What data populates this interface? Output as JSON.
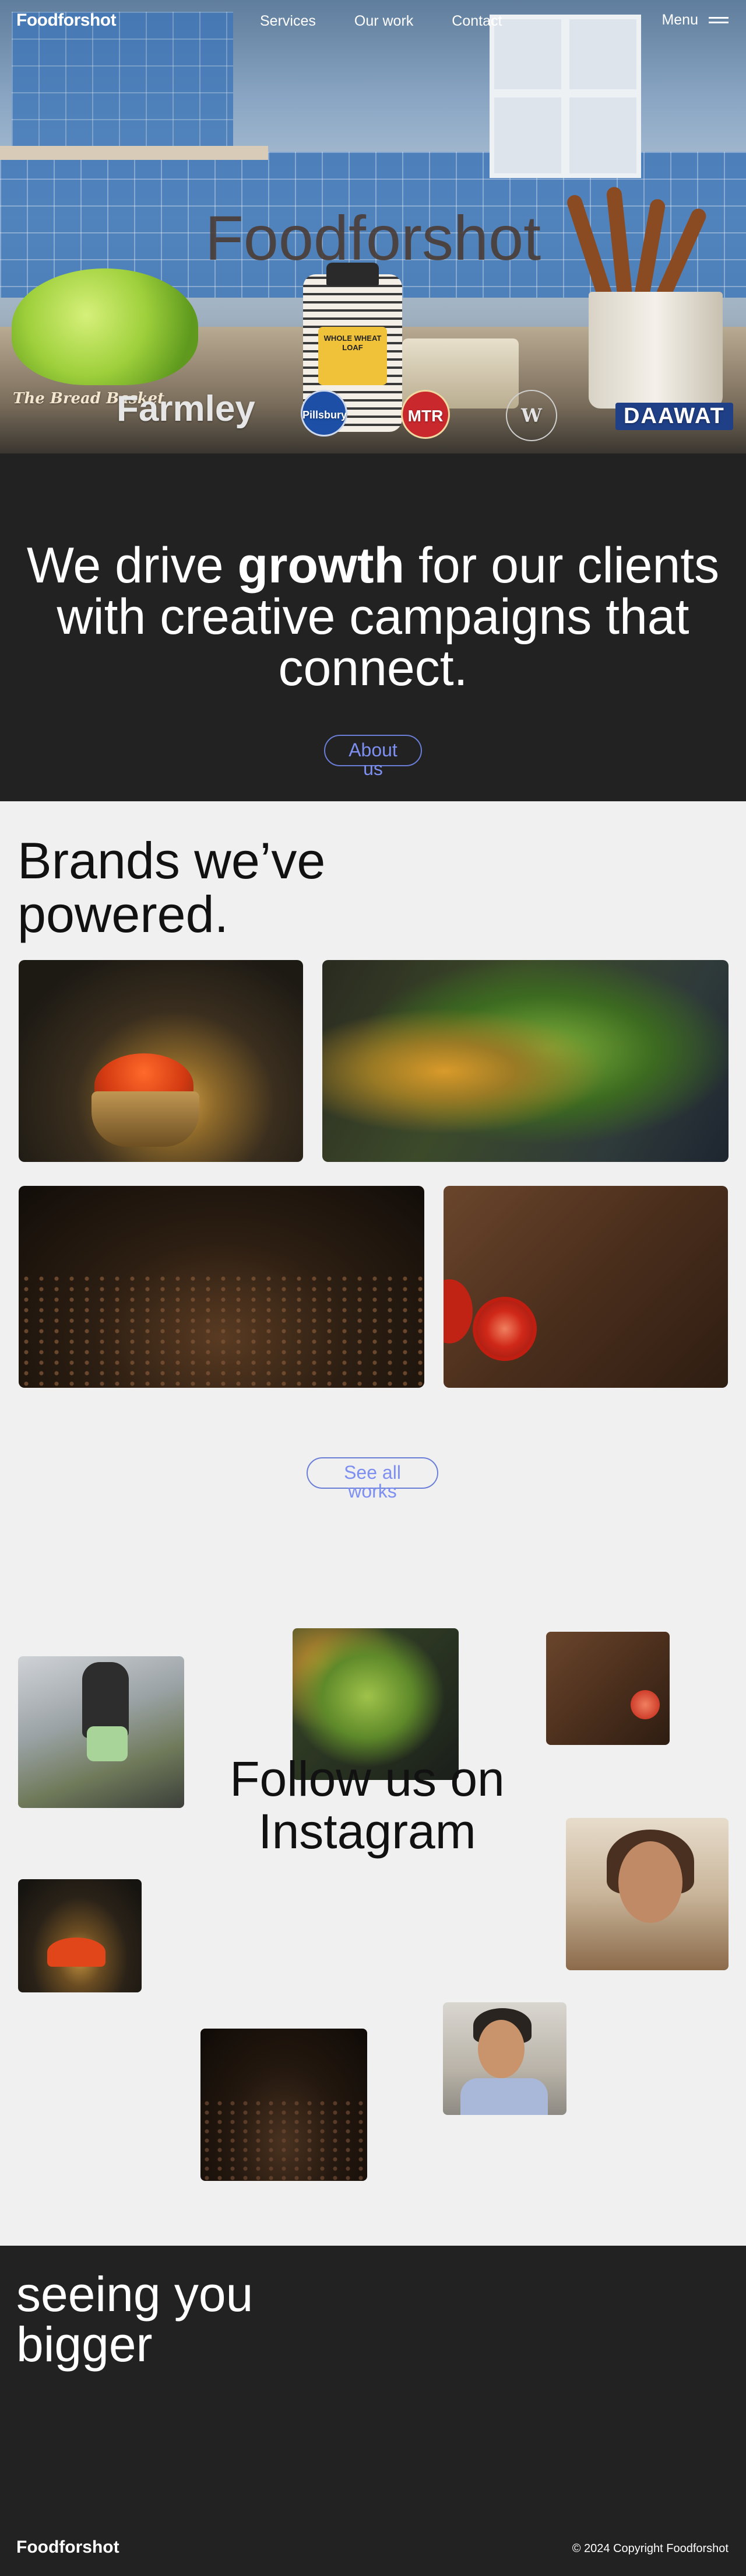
{
  "nav": {
    "logo": "Foodforshot",
    "links": [
      "Services",
      "Our work",
      "Contact"
    ],
    "menu_label": "Menu"
  },
  "hero": {
    "title": "Foodforshot",
    "jar_label": "WHOLE WHEAT LOAF",
    "brand_logos": {
      "parle": "The Bread Basket",
      "farmley": "Farmley",
      "pillsbury": "Pillsbury",
      "mtr": "MTR",
      "wb": "W",
      "daawat": "DAAWAT"
    }
  },
  "growth": {
    "text_before": "We drive ",
    "text_bold": "growth",
    "text_after": " for our clients with creative campaigns that connect.",
    "button": "About us"
  },
  "brands": {
    "title_line1": "Brands we’ve",
    "title_line2": "powered.",
    "button": "See all works"
  },
  "instagram": {
    "title_line1": "Follow us on",
    "title_line2": "Instagram"
  },
  "footer": {
    "tagline_line1": "seeing you",
    "tagline_line2": "bigger",
    "logo": "Foodforshot",
    "copyright": "© 2024 Copyright Foodforshot"
  },
  "colors": {
    "dark_bg": "#222222",
    "light_bg": "#f0f0f0",
    "accent": "#7d8ff0"
  }
}
